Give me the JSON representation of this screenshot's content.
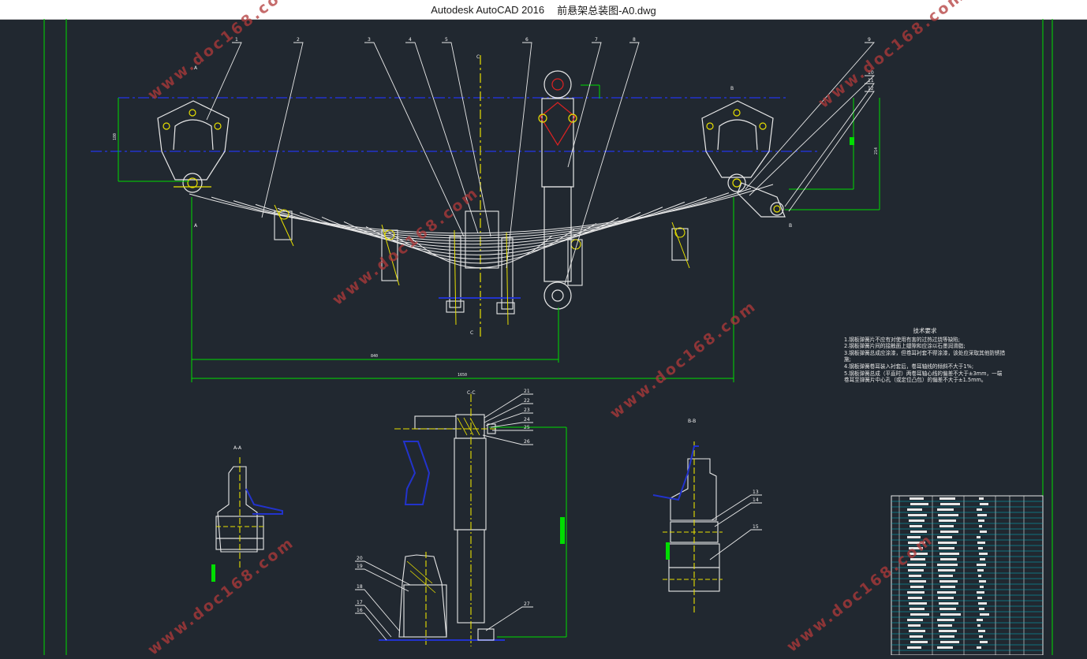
{
  "window": {
    "app_name": "Autodesk AutoCAD 2016",
    "file_name": "前悬架总装图-A0.dwg"
  },
  "colors": {
    "background": "#212830",
    "frame_green": "#00dd00",
    "outline_white": "#e8e8e8",
    "centerline_blue": "#2233cc",
    "centerline_yellow": "#e8e000",
    "shaft_red": "#dd2222",
    "watermark_red": "#b23a3a"
  },
  "technical_requirements": {
    "title": "技术要求",
    "items": [
      "1.钢板弹簧片不应有对使用有害的过热过烧等缺陷;",
      "2.钢板弹簧片间的接触面上缝隙和应涂以石墨润滑脂;",
      "3.钢板弹簧总成应涂漆，但卷耳衬套不得涂漆，该处应采取其他防锈措施;",
      "4.钢板弹簧卷耳装入衬套后，卷耳轴线的倾斜不大于1%;",
      "5.钢板弹簧总成（平直时）两卷耳轴心线的偏差不大于±3mm，一端卷耳至弹簧片中心孔（或定位凸包）的偏差不大于±1.5mm。"
    ]
  },
  "balloons_top": [
    "1",
    "2",
    "3",
    "4",
    "5",
    "6",
    "7",
    "8",
    "9",
    "10",
    "11",
    "12"
  ],
  "balloons_shock": [
    "21",
    "22",
    "23",
    "24",
    "25",
    "26",
    "27"
  ],
  "balloons_bumper": [
    "20",
    "19",
    "18",
    "17",
    "16"
  ],
  "balloons_right_section": [
    "13",
    "14",
    "15"
  ],
  "section_labels": {
    "section_aa": "A-A",
    "section_bb": "B-B",
    "section_cc": "C-C",
    "marker_a": "A",
    "marker_b": "B",
    "marker_c": "C"
  },
  "dimensions": {
    "overall_length": "1650",
    "half_length": "840",
    "height_left": "180",
    "height_right": "214"
  },
  "watermark": "www.doc168.com"
}
